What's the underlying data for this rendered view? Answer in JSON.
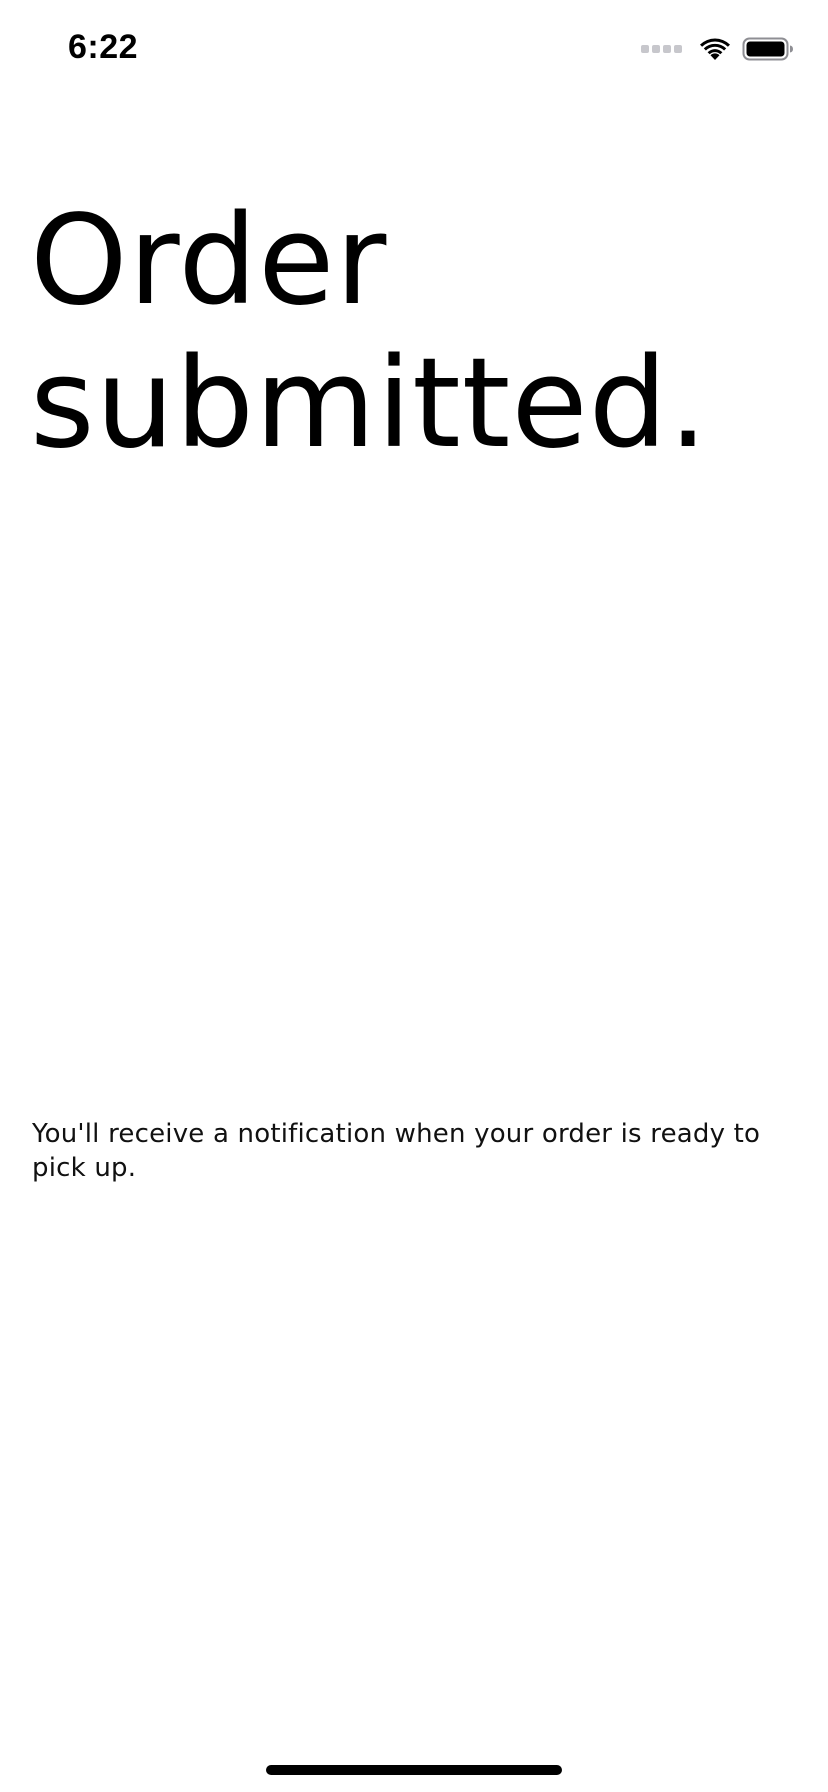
{
  "status_bar": {
    "time": "6:22",
    "icons": [
      "cellular-signal-icon",
      "wifi-icon",
      "battery-icon"
    ]
  },
  "confirmation": {
    "title": "Order submitted.",
    "message": "You'll receive a notification when your order is ready to pick up."
  },
  "colors": {
    "background": "#ffffff",
    "text": "#000000",
    "signal_inactive": "#c7c7cc"
  }
}
